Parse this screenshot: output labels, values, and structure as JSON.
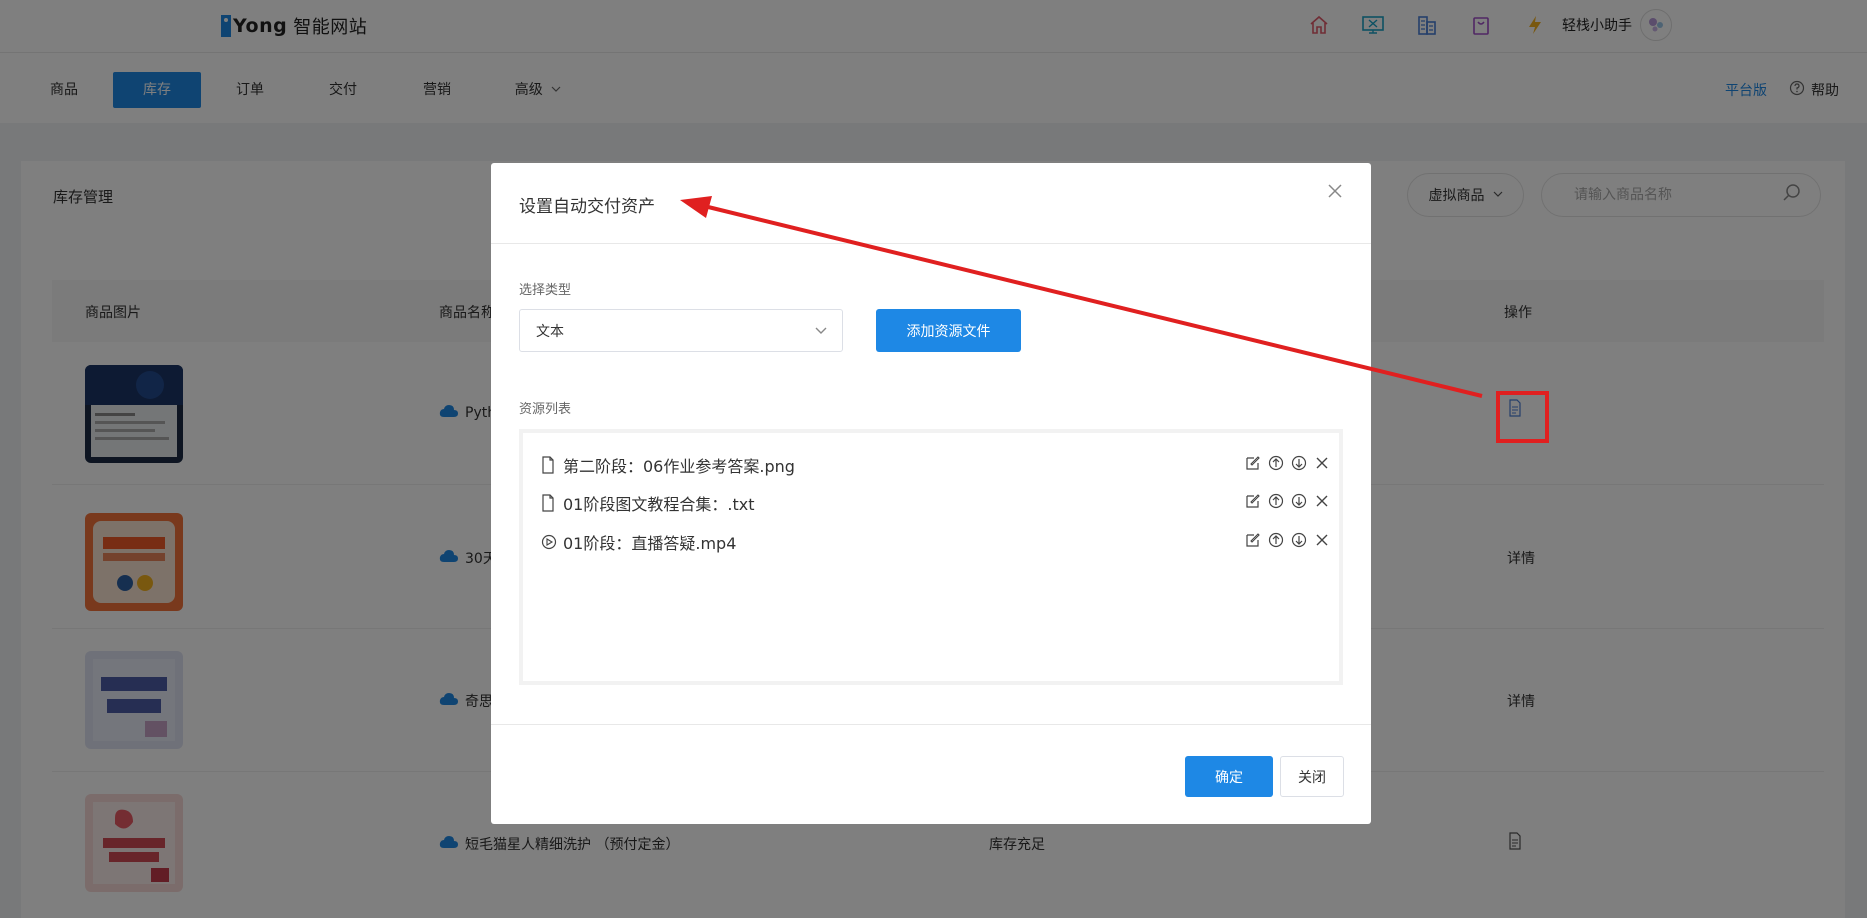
{
  "brand": {
    "logo_text": "Yong",
    "logo_sub": "智能网站"
  },
  "top_icons": [
    "home-icon",
    "monitor-icon",
    "building-icon",
    "bag-icon",
    "lightning-icon"
  ],
  "colors": {
    "primary": "#1e88e5",
    "annotation_red": "#e02020"
  },
  "user": {
    "name": "轻栈小助手"
  },
  "nav": {
    "items": [
      {
        "label": "商品"
      },
      {
        "label": "库存"
      },
      {
        "label": "订单"
      },
      {
        "label": "交付"
      },
      {
        "label": "营销"
      },
      {
        "label": "高级"
      }
    ],
    "active": "库存",
    "platform": "平台版",
    "help": "帮助"
  },
  "page": {
    "title": "库存管理",
    "filter_label": "虚拟商品",
    "search_placeholder": "请输入商品名称"
  },
  "table": {
    "columns": [
      "商品图片",
      "商品名称",
      "操作"
    ],
    "rows": [
      {
        "name": "Pyth",
        "stock": "",
        "op": ""
      },
      {
        "name": "30天",
        "stock": "",
        "op": "详情"
      },
      {
        "name": "奇思",
        "stock": "",
        "op": "详情"
      },
      {
        "name": "短毛猫星人精细洗护 （预付定金）",
        "stock": "库存充足",
        "op": ""
      }
    ]
  },
  "modal": {
    "title": "设置自动交付资产",
    "type_label": "选择类型",
    "type_value": "文本",
    "add_button": "添加资源文件",
    "list_label": "资源列表",
    "resources": [
      {
        "name": "第二阶段：06作业参考答案.png",
        "icon": "file-icon"
      },
      {
        "name": "01阶段图文教程合集：.txt",
        "icon": "file-icon"
      },
      {
        "name": "01阶段：直播答疑.mp4",
        "icon": "play-icon"
      }
    ],
    "ok_button": "确定",
    "close_button": "关闭"
  }
}
